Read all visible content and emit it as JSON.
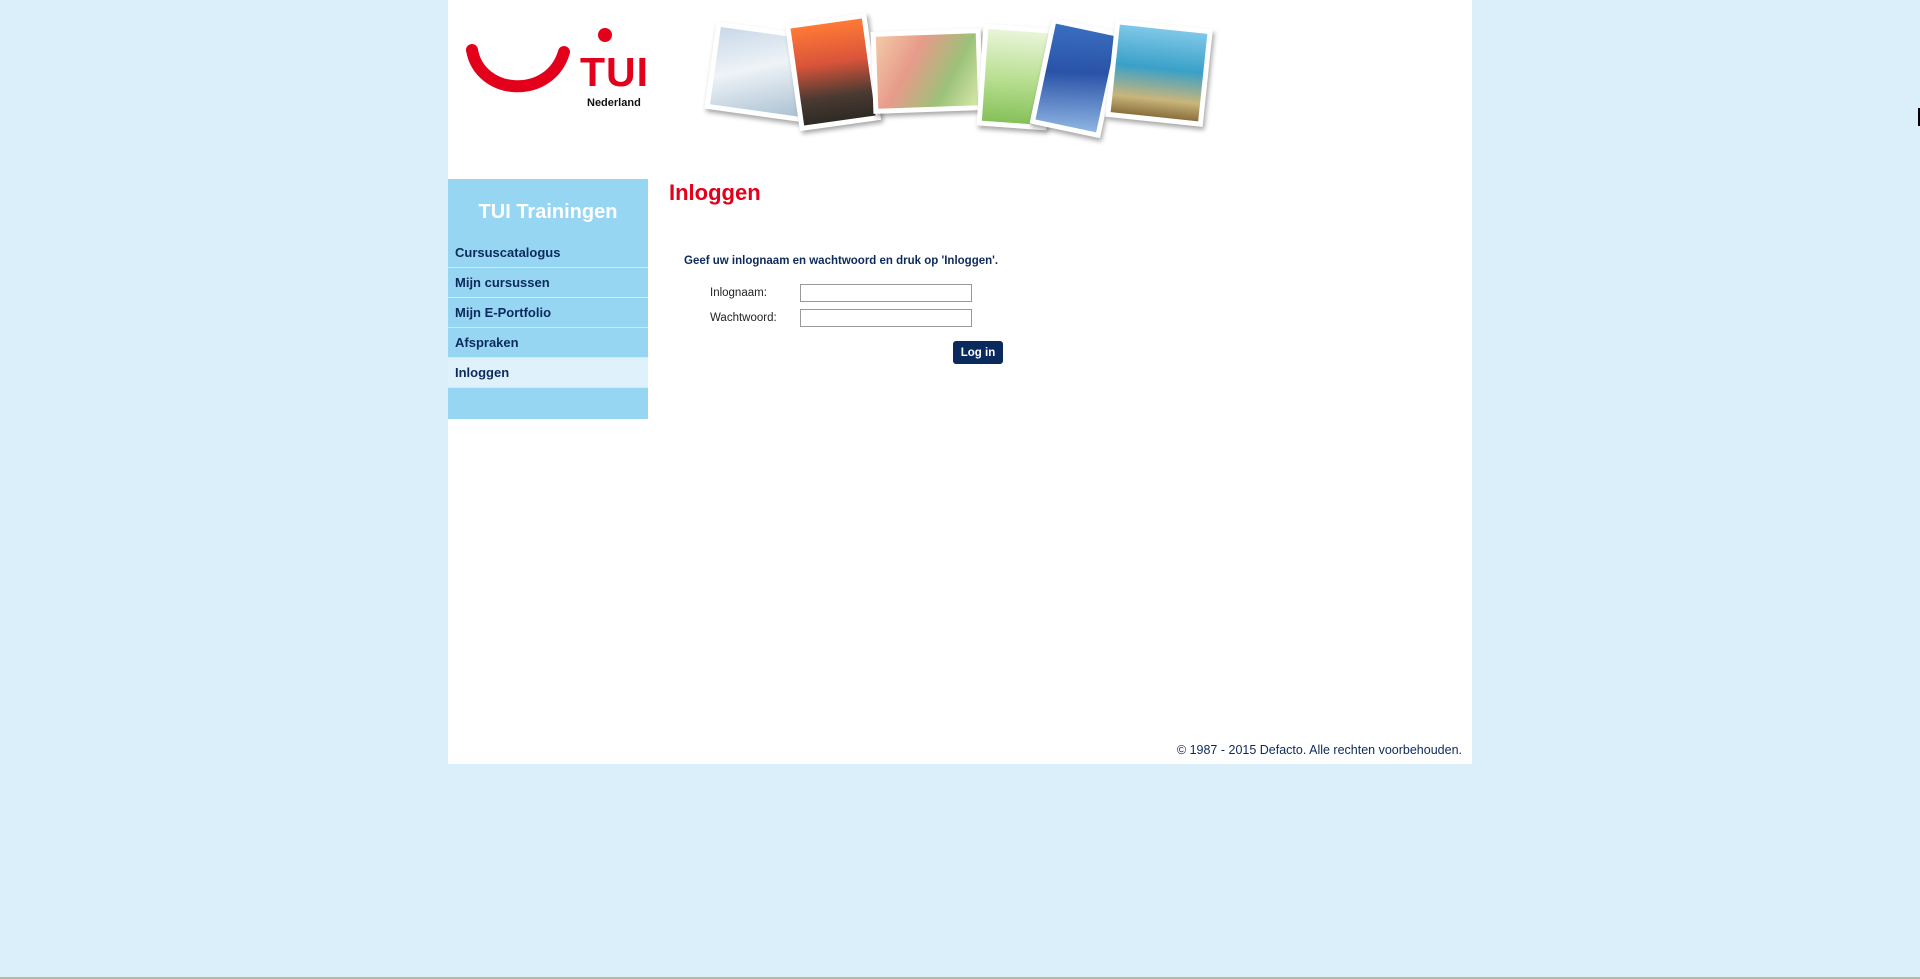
{
  "brand": {
    "name": "TUI",
    "subtitle": "Nederland",
    "color": "#e2001a"
  },
  "sidebar": {
    "title": "TUI Trainingen",
    "items": [
      {
        "label": "Cursuscatalogus",
        "active": false
      },
      {
        "label": "Mijn cursussen",
        "active": false
      },
      {
        "label": "Mijn E-Portfolio",
        "active": false
      },
      {
        "label": "Afspraken",
        "active": false
      },
      {
        "label": "Inloggen",
        "active": true
      }
    ]
  },
  "main": {
    "title": "Inloggen",
    "instructions": "Geef uw inlognaam en wachtwoord en druk op 'Inloggen'.",
    "form": {
      "username_label": "Inlognaam:",
      "username_value": "",
      "password_label": "Wachtwoord:",
      "password_value": "",
      "submit_label": "Log in"
    }
  },
  "footer": {
    "copyright": "© 1987 - 2015 Defacto. Alle rechten voorbehouden."
  },
  "colors": {
    "background": "#daeffa",
    "sidebar": "#97d6f3",
    "nav_text": "#0d2a5c",
    "button": "#0a2a5e"
  }
}
